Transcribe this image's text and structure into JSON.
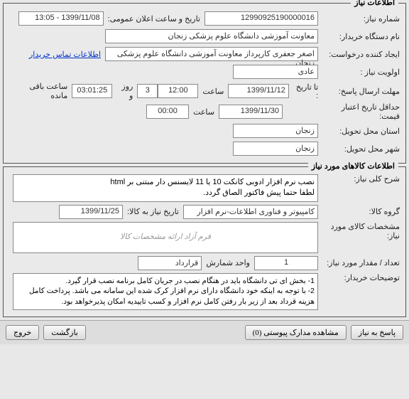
{
  "panel1": {
    "title": "اطلاعات نیاز",
    "rows": {
      "need_no_label": "شماره نیاز:",
      "need_no": "12990925190000016",
      "public_date_label": "تاریخ و ساعت اعلان عمومی:",
      "public_date": "1399/11/08 - 13:05",
      "org_label": "نام دستگاه خریدار:",
      "org": "معاونت آموزشی دانشگاه علوم پزشکی زنجان",
      "creator_label": "ایجاد کننده درخواست:",
      "creator": "اصغر  جعفری کارپرداز معاونت آموزشی دانشگاه علوم پزشکی زنجان",
      "contact_link": "اطلاعات تماس خریدار",
      "priority_label": "اولویت نیاز :",
      "priority": "عادی",
      "deadline_label": "مهلت ارسال پاسخ:",
      "deadline_sub": "تا تاریخ :",
      "deadline_date": "1399/11/12",
      "hour_label": "ساعت",
      "deadline_time": "12:00",
      "days_remaining": "3",
      "days_label": "روز و",
      "time_remaining": "03:01:25",
      "remain_label": "ساعت باقی مانده",
      "min_valid_label": "حداقل تاریخ اعتبار قیمت:",
      "min_valid_date": "1399/11/30",
      "min_valid_time": "00:00",
      "province_label": "استان محل تحویل:",
      "province": "زنجان",
      "city_label": "شهر محل تحویل:",
      "city": "زنجان"
    }
  },
  "panel2": {
    "title": "اطلاعات کالاهای مورد نیاز",
    "rows": {
      "desc_label": "شرح کلی نیاز:",
      "desc": "نصب نرم افزار ادوبی کانکت 10 یا 11 لایسنس دار مبتنی بر html\nلطفا حتما پیش فاکتور الصاق گردد.",
      "group_label": "گروه کالا:",
      "group": "کامپیوتر و فناوری اطلاعات-نرم افزار",
      "need_until_label": "تاریخ نیاز به کالا:",
      "need_until": "1399/11/25",
      "spec_label": "مشخصات کالای مورد نیاز:",
      "spec_img_alt": "فرم آزاد ارائه مشخصات کالا",
      "qty_label": "تعداد / مقدار مورد نیاز:",
      "qty": "1",
      "unit_label": "واحد شمارش",
      "unit": "قرارداد",
      "notes_label": "توضیحات خریدار:",
      "notes": "1- بخش ای تی دانشگاه باید در هنگام نصب در جریان کامل برنامه نصب قرار گیرد.\n2- با توجه به اینکه خود دانشگاه دارای نرم افزار کرک شده این سامانه می باشد. پرداخت کامل هزینه قرداد بعد از زیر بار رفتن کامل نرم افزار و کسب تاییدیه امکان پذیرخواهد بود."
    }
  },
  "buttons": {
    "reply": "پاسخ به نیاز",
    "attachments": "مشاهده مدارک پیوستی (0)",
    "back": "بازگشت",
    "exit": "خروج"
  }
}
